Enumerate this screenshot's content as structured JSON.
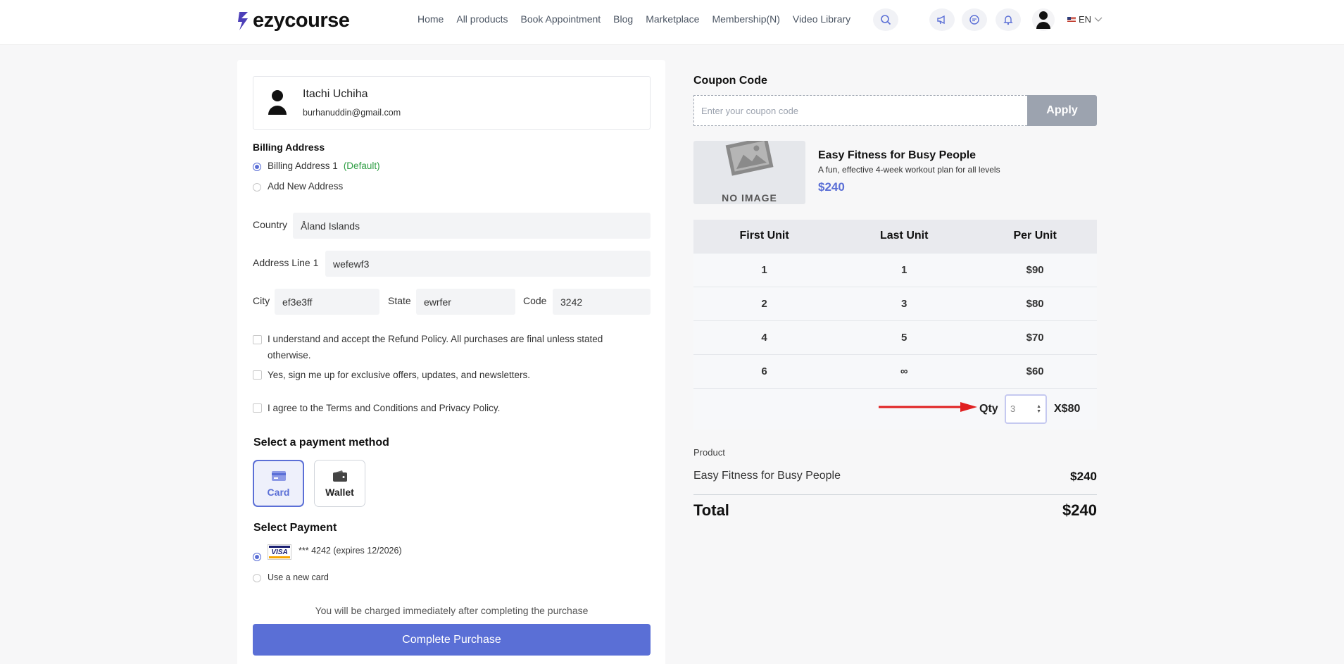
{
  "header": {
    "logo_text": "ezycourse",
    "nav": [
      "Home",
      "All products",
      "Book Appointment",
      "Blog",
      "Marketplace",
      "Membership(N)",
      "Video Library"
    ],
    "language": "EN",
    "icons": [
      "search-icon",
      "megaphone-icon",
      "chat-icon",
      "bell-icon",
      "user-avatar-icon",
      "us-flag-icon",
      "chevron-down-icon"
    ]
  },
  "user": {
    "name": "Itachi Uchiha",
    "email": "burhanuddin@gmail.com"
  },
  "billing": {
    "title": "Billing Address",
    "options": [
      {
        "label": "Billing Address 1",
        "tag": "(Default)",
        "selected": true
      },
      {
        "label": "Add New Address",
        "selected": false
      }
    ],
    "fields": {
      "country_label": "Country",
      "country_value": "Åland Islands",
      "address_label": "Address Line 1",
      "address_value": "wefewf3",
      "city_label": "City",
      "city_value": "ef3e3ff",
      "state_label": "State",
      "state_value": "ewrfer",
      "code_label": "Code",
      "code_value": "3242"
    }
  },
  "agreements": [
    {
      "label": "I understand and accept the Refund Policy. All purchases are final unless stated otherwise.",
      "checked": false
    },
    {
      "label": "Yes, sign me up for exclusive offers, updates, and newsletters.",
      "checked": false
    },
    {
      "label": "I agree to the Terms and Conditions and Privacy Policy.",
      "checked": false
    }
  ],
  "payment_method": {
    "title": "Select a payment method",
    "options": [
      {
        "label": "Card",
        "icon": "card-icon",
        "active": true
      },
      {
        "label": "Wallet",
        "icon": "wallet-icon",
        "active": false
      }
    ]
  },
  "select_payment": {
    "title": "Select Payment",
    "saved_card": {
      "brand": "VISA",
      "text": "*** 4242  (expires 12/2026)",
      "selected": true
    },
    "new_card_label": "Use a new card"
  },
  "charged_note": "You will be charged immediately after completing the purchase",
  "complete_button": "Complete Purchase",
  "coupon": {
    "label": "Coupon Code",
    "placeholder": "Enter your coupon code",
    "apply": "Apply"
  },
  "product": {
    "image_text": "NO IMAGE",
    "title": "Easy Fitness for Busy People",
    "description": "A fun, effective 4-week workout plan for all levels",
    "price": "$240"
  },
  "tier_table": {
    "headers": [
      "First Unit",
      "Last Unit",
      "Per Unit"
    ],
    "rows": [
      [
        "1",
        "1",
        "$90"
      ],
      [
        "2",
        "3",
        "$80"
      ],
      [
        "4",
        "5",
        "$70"
      ],
      [
        "6",
        "∞",
        "$60"
      ]
    ]
  },
  "quantity": {
    "label": "Qty",
    "value": "3",
    "unit_price": "X$80"
  },
  "summary": {
    "product_label": "Product",
    "product_name": "Easy Fitness for Busy People",
    "product_price": "$240",
    "total_label": "Total",
    "total_value": "$240"
  },
  "colors": {
    "accent": "#5b6fd6",
    "default_tag": "#2f9e44",
    "apply_disabled": "#9ca3af",
    "annotation_arrow": "#e02020"
  }
}
